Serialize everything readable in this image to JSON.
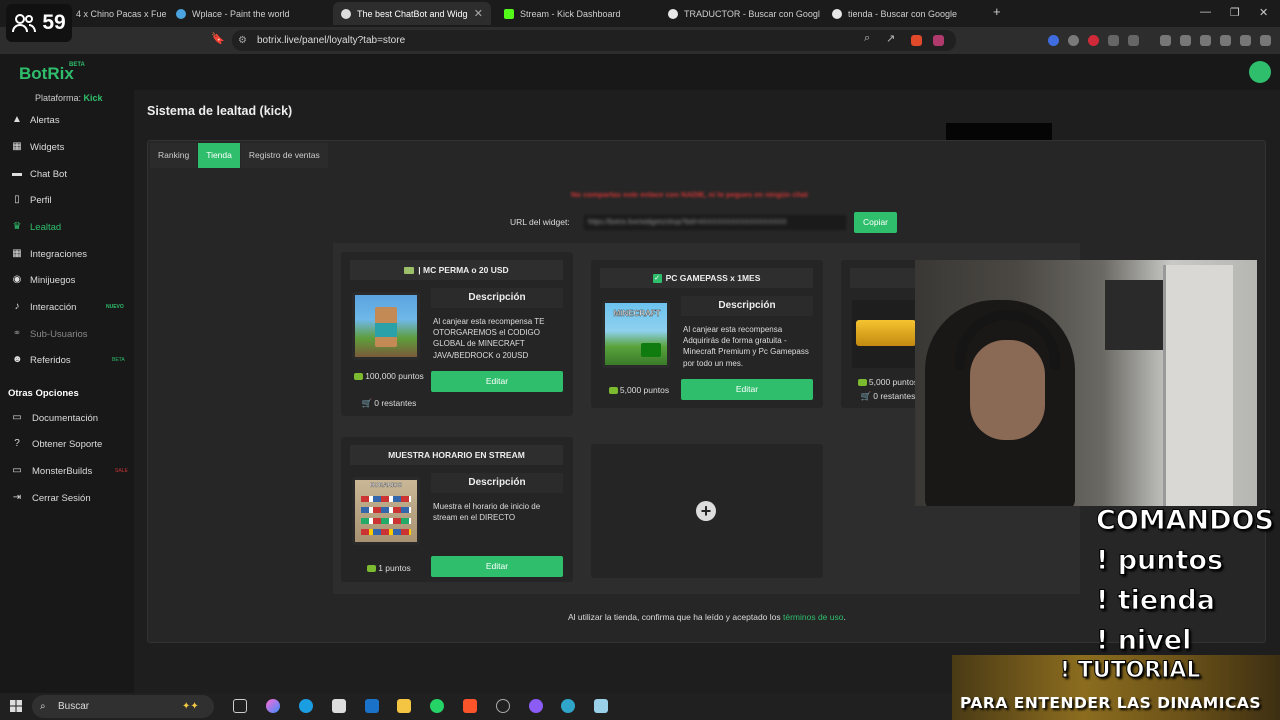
{
  "viewer": {
    "count": "59"
  },
  "browser": {
    "tabs": [
      {
        "label": "4 x Chino Pacas x Fuerz"
      },
      {
        "label": "Wplace - Paint the world"
      },
      {
        "label": "The best ChatBot and Widgets fo"
      },
      {
        "label": "Stream - Kick Dashboard"
      },
      {
        "label": "TRADUCTOR - Buscar con Google"
      },
      {
        "label": "tienda - Buscar con Google"
      }
    ],
    "url": "botrix.live/panel/loyalty?tab=store"
  },
  "app": {
    "logo": "BotRix",
    "logo_badge": "BETA",
    "platform_label": "Plataforma:",
    "platform_value": "Kick"
  },
  "sidebar": {
    "items": [
      {
        "label": "Alertas"
      },
      {
        "label": "Widgets"
      },
      {
        "label": "Chat Bot"
      },
      {
        "label": "Perfil"
      },
      {
        "label": "Lealtad"
      },
      {
        "label": "Integraciones"
      },
      {
        "label": "Minijuegos"
      },
      {
        "label": "Interacción",
        "badge": "NUEVO"
      },
      {
        "label": "Sub-Usuarios"
      },
      {
        "label": "Referidos",
        "badge": "BETA"
      }
    ],
    "section_title": "Otras Opciones",
    "other_items": [
      {
        "label": "Documentación"
      },
      {
        "label": "Obtener Soporte"
      },
      {
        "label": "MonsterBuilds",
        "badge": "SALE"
      },
      {
        "label": "Cerrar Sesión"
      }
    ]
  },
  "main": {
    "title": "Sistema de lealtad (kick)",
    "tabs": [
      {
        "label": "Ranking"
      },
      {
        "label": "Tienda"
      },
      {
        "label": "Registro de ventas"
      }
    ],
    "warning": "No compartas este enlace con NADIE, ni lo pegues en ningún chat",
    "url_label": "URL del widget:",
    "url_value": "https://botrix.live/widgets/shop?bid=4XXXXXXXXXXXXXXXXXX",
    "copy_label": "Copiar",
    "footer_text": "Al utilizar la tienda, confirma que ha leído y aceptado los ",
    "footer_link": "términos de uso",
    "footer_end": "."
  },
  "store": {
    "description_label": "Descripción",
    "edit_label": "Editar",
    "items": [
      {
        "title": "| MC PERMA o 20 USD",
        "description": "Al canjear esta recompensa TE OTORGAREMOS el CODIGO GLOBAL de MINECRAFT JAVA/BEDROCK o 20USD",
        "points": "100,000 puntos",
        "remaining": "0 restantes"
      },
      {
        "title": "PC GAMEPASS x 1MES",
        "description": "Al canjear esta recompensa Adquirirás de forma gratuita - Minecraft Premium y Pc Gamepass por todo un mes.",
        "points": "5,000 puntos",
        "image_text": "MINECRAFT"
      },
      {
        "points": "5,000 puntos",
        "remaining": "0 restantes"
      },
      {
        "title": "MUESTRA HORARIO EN STREAM",
        "description": "Muestra el horario de inicio de stream en el DIRECTO",
        "points": "1 puntos",
        "image_text": "HORARIOS"
      }
    ]
  },
  "overlay": {
    "commands": [
      "COMANDOS",
      "! puntos",
      "! tienda",
      "! nivel"
    ],
    "tutorial_title": "! TUTORIAL",
    "tutorial_sub": "PARA ENTENDER LAS DINAMICAS"
  },
  "taskbar": {
    "search_placeholder": "Buscar"
  },
  "colors": {
    "accent": "#2fbf6c",
    "warning": "#d03535",
    "link": "#2fbf6c"
  }
}
